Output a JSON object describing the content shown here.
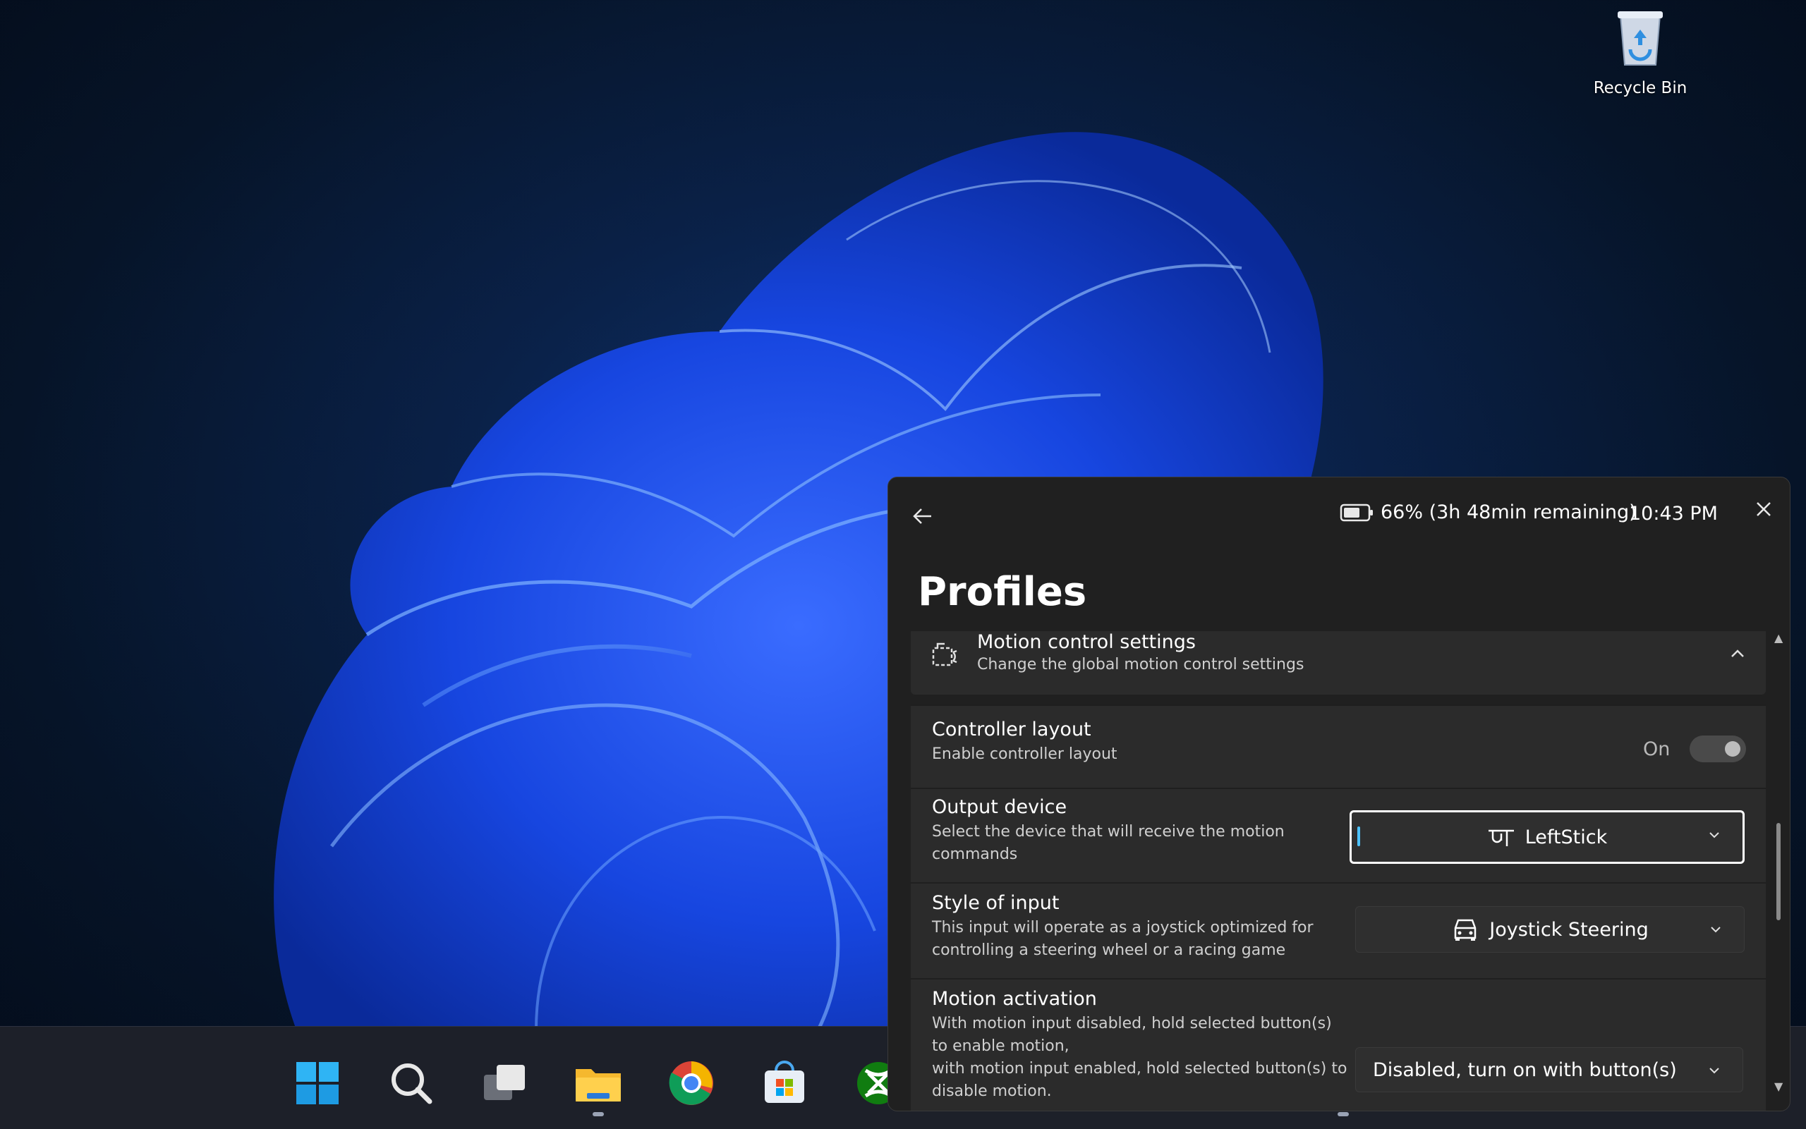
{
  "desktop": {
    "icons": [
      {
        "label": "Recycle Bin",
        "icon": "recycle-bin-icon"
      }
    ]
  },
  "taskbar": {
    "apps": [
      {
        "name": "start",
        "icon": "windows-logo-icon"
      },
      {
        "name": "search",
        "icon": "search-icon"
      },
      {
        "name": "task-view",
        "icon": "task-view-icon"
      },
      {
        "name": "file-explorer",
        "icon": "folder-icon"
      },
      {
        "name": "chrome",
        "icon": "chrome-icon"
      },
      {
        "name": "microsoft-store",
        "icon": "store-icon"
      },
      {
        "name": "xbox",
        "icon": "xbox-icon"
      }
    ]
  },
  "panel": {
    "battery": "66% (3h 48min remaining)",
    "time": "10:43 PM",
    "title": "Profiles",
    "expander": {
      "title": "Motion control settings",
      "subtitle": "Change the global motion control settings",
      "icon": "motion-settings-icon"
    },
    "rows": {
      "controller_layout": {
        "title": "Controller layout",
        "desc": "Enable controller layout",
        "toggle_label": "On",
        "toggle_on": true
      },
      "output_device": {
        "title": "Output device",
        "desc": "Select the device that will receive the motion commands",
        "value": "LeftStick",
        "icon": "joystick-icon"
      },
      "style_of_input": {
        "title": "Style of input",
        "desc": "This input will operate as a joystick optimized for controlling a steering wheel or a racing game",
        "value": "Joystick Steering",
        "icon": "car-icon"
      },
      "motion_activation": {
        "title": "Motion activation",
        "desc1": "With motion input disabled, hold selected button(s) to enable motion,",
        "desc2": "with motion input enabled, hold selected button(s) to disable motion.",
        "value": "Disabled, turn on with button(s)"
      }
    }
  },
  "colors": {
    "accent": "#4cc2ff",
    "panel_bg": "#202020",
    "card_bg": "#2b2b2b"
  }
}
